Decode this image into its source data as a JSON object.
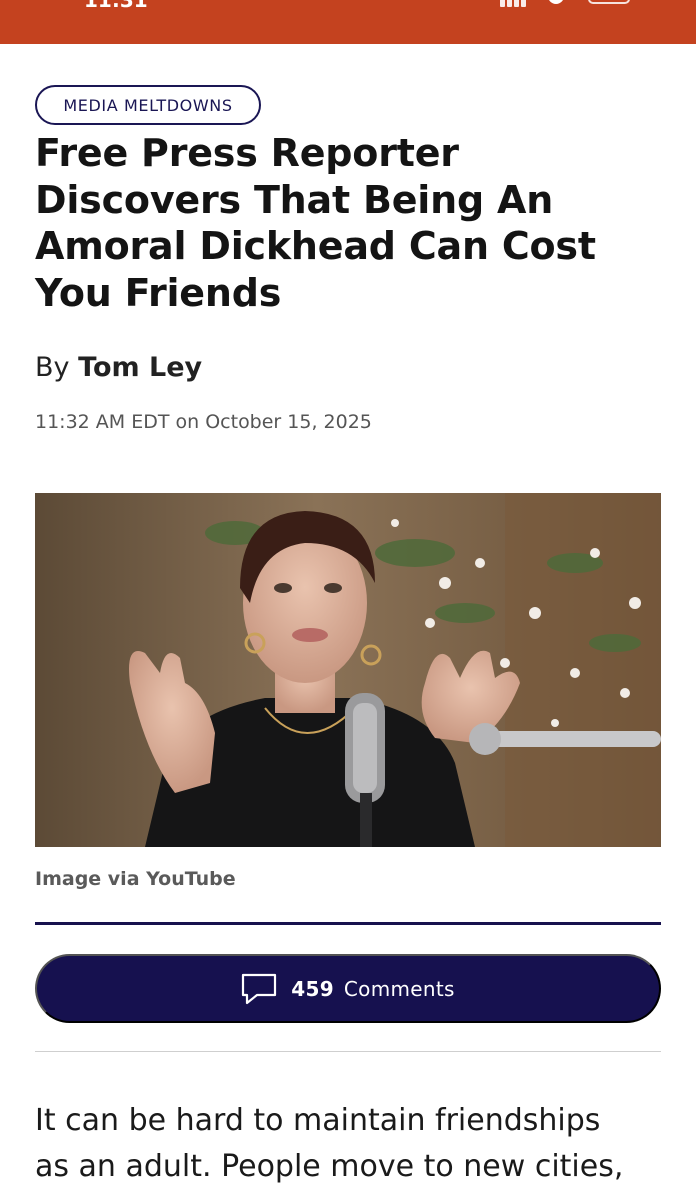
{
  "status_bar": {
    "time": "11:31"
  },
  "article": {
    "category": "MEDIA MELTDOWNS",
    "headline": "Free Press Reporter Discovers That Being An Amoral Dickhead Can Cost You Friends",
    "byline_prefix": "By",
    "author": "Tom Ley",
    "timestamp": "11:32 AM EDT on October 15, 2025",
    "image_caption": "Image via YouTube",
    "comments_count": "459",
    "comments_label": "Comments",
    "body_lines": [
      "It can be hard to maintain friendships",
      "as an adult. People move to new cities,"
    ]
  },
  "colors": {
    "status_bar": "#c4421f",
    "navy": "#16114f",
    "text": "#141414"
  },
  "icons": {
    "comments": "speech-bubble-icon"
  }
}
